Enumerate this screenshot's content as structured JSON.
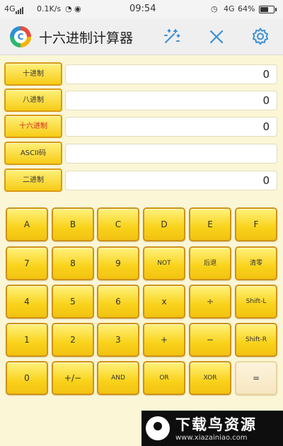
{
  "status_bar": {
    "network": "4G",
    "speed": "0.1K/s",
    "time": "09:54",
    "network_right": "4G",
    "battery": "64%",
    "battery_level": 0.64
  },
  "header": {
    "app_icon_letter": "C",
    "title": "十六进制计算器"
  },
  "converters": [
    {
      "label": "十进制",
      "value": "0"
    },
    {
      "label": "八进制",
      "value": "0"
    },
    {
      "label": "十六进制",
      "value": "0"
    },
    {
      "label": "ASCII码",
      "value": ""
    },
    {
      "label": "二进制",
      "value": "0"
    }
  ],
  "keypad": {
    "rows": [
      [
        "A",
        "B",
        "C",
        "D",
        "E",
        "F"
      ],
      [
        "7",
        "8",
        "9",
        "NOT",
        "后退",
        "清零"
      ],
      [
        "4",
        "5",
        "6",
        "x",
        "÷",
        "Shift-L"
      ],
      [
        "1",
        "2",
        "3",
        "+",
        "−",
        "Shift-R"
      ],
      [
        "0",
        "+/−",
        "AND",
        "OR",
        "XOR",
        "="
      ]
    ]
  },
  "watermark": {
    "title": "下载鸟资源",
    "url": "www.xiazainiao.com"
  }
}
